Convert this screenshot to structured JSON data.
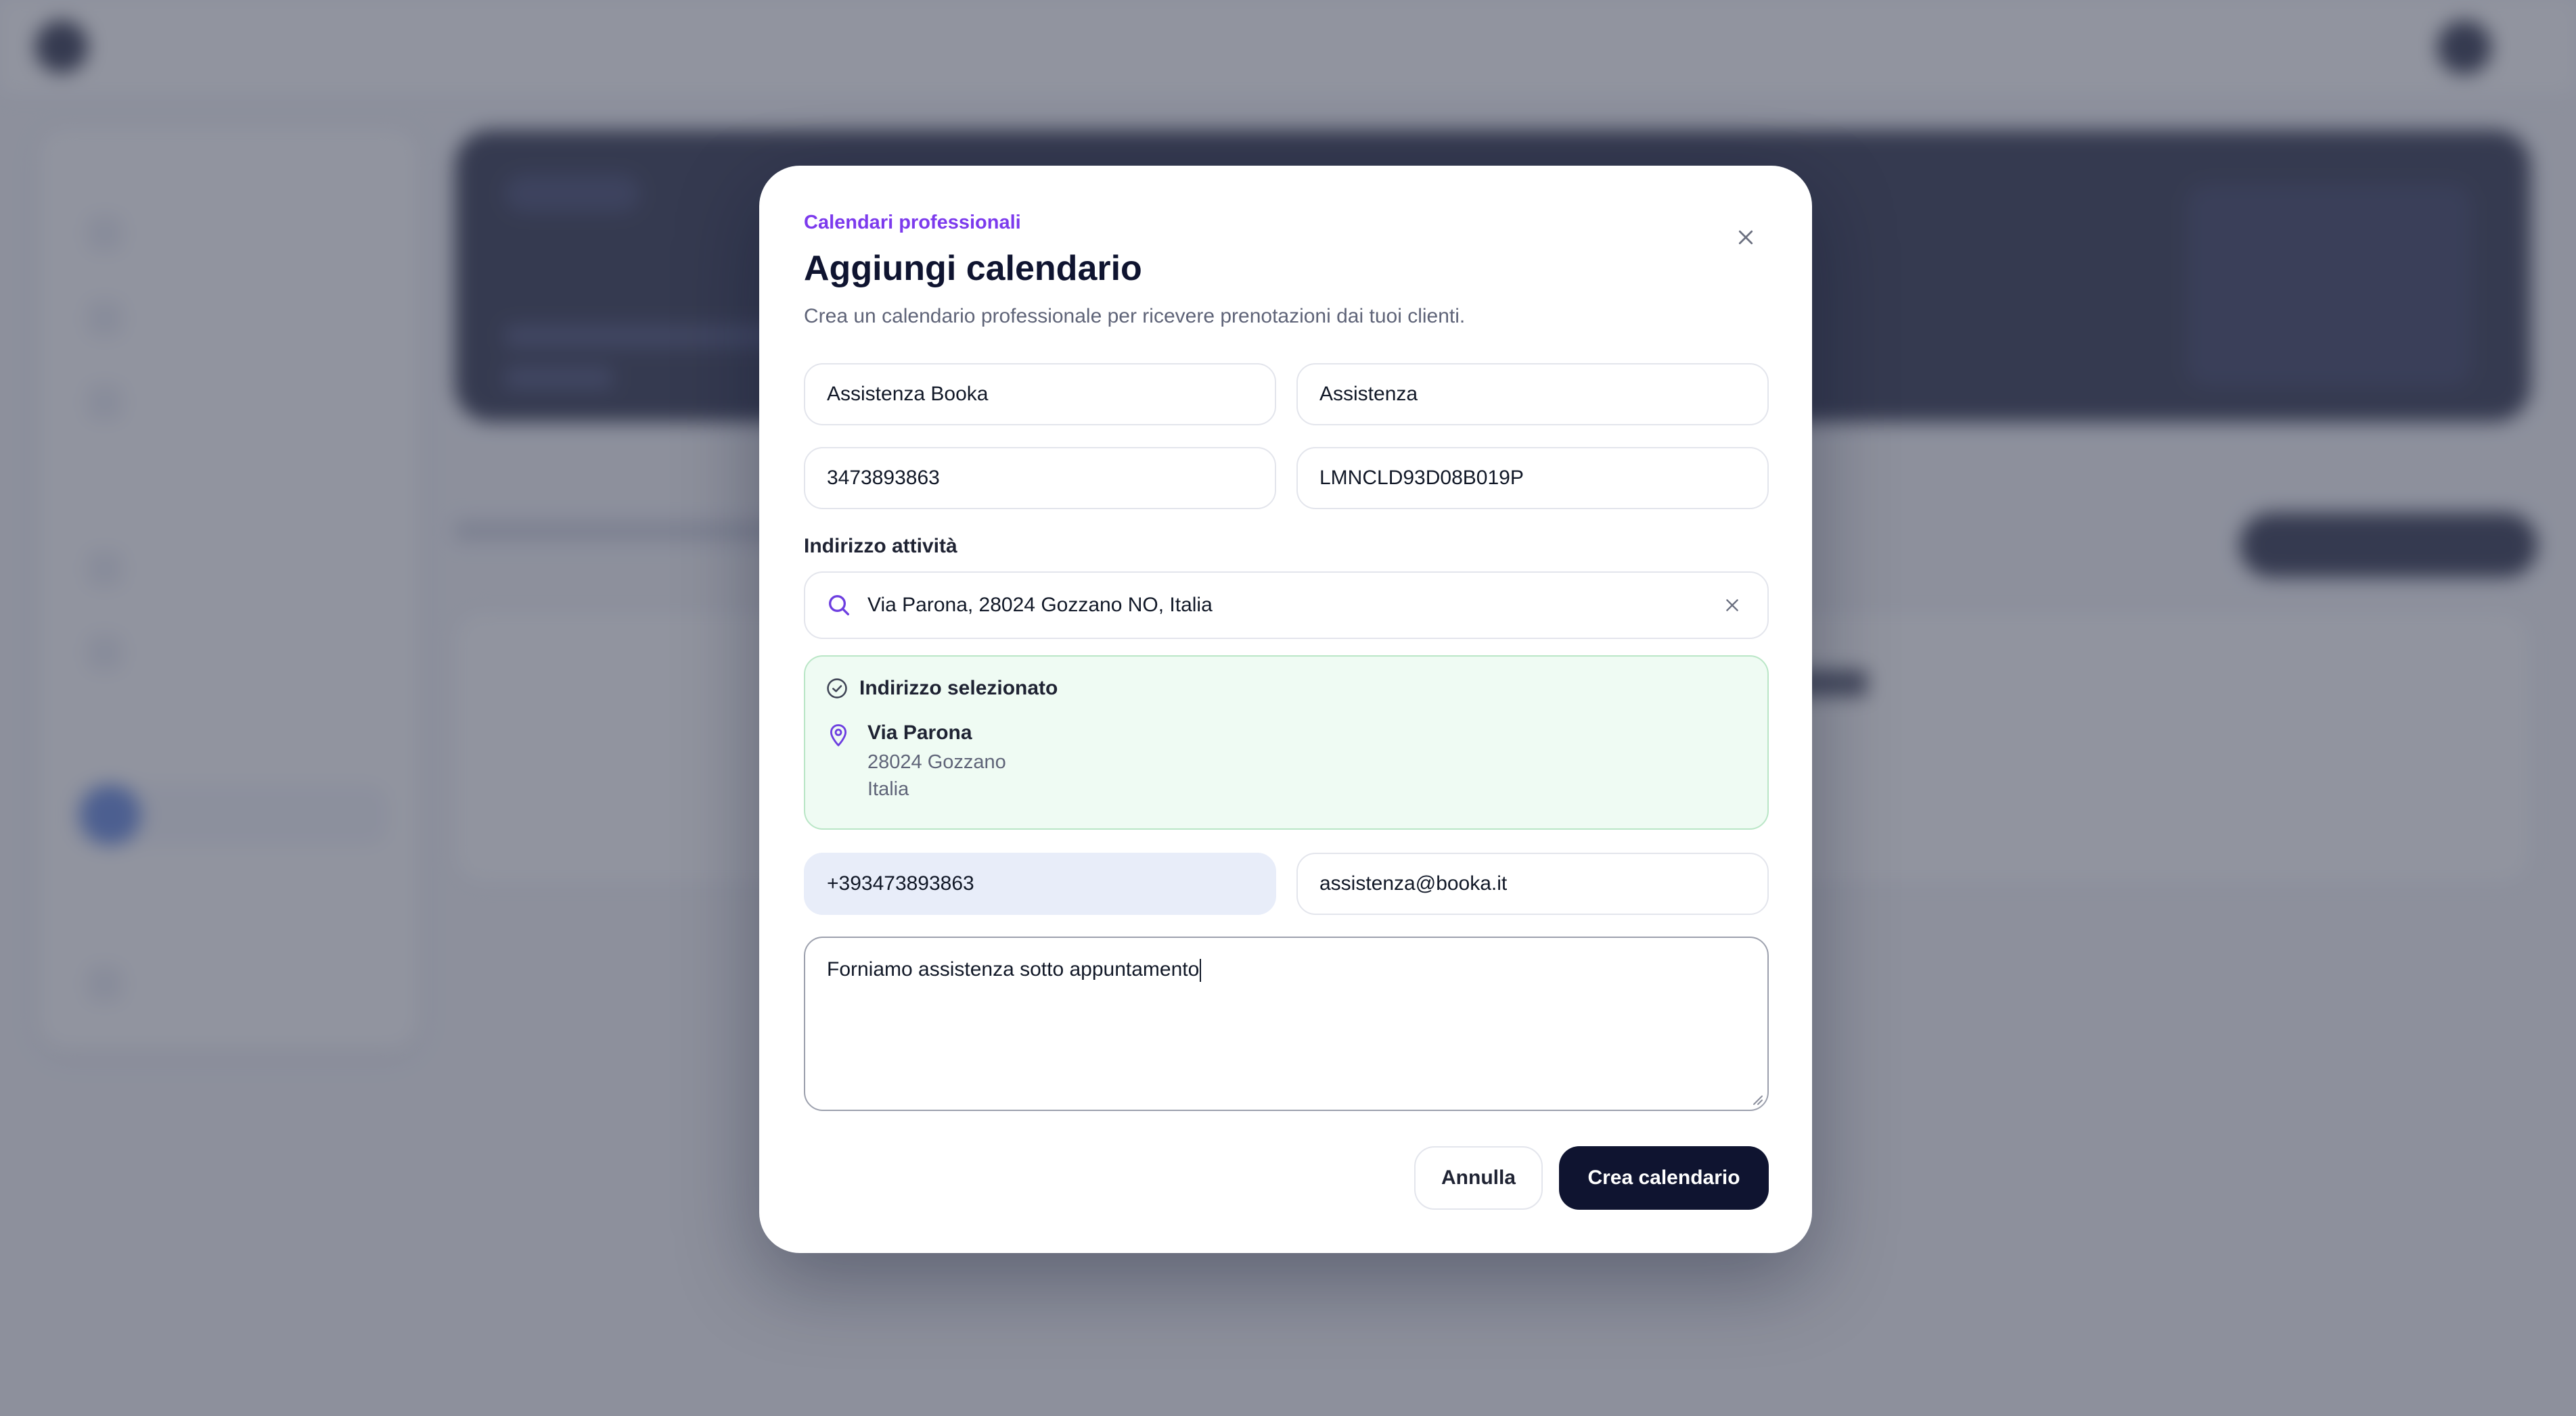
{
  "colors": {
    "accent": "#7c3aed",
    "primary": "#0f1430",
    "success_bg": "#effbf3",
    "success_border": "#b9e6c6",
    "overlay": "rgba(78,82,100,0.62)"
  },
  "modal": {
    "eyebrow": "Calendari professionali",
    "title": "Aggiungi calendario",
    "subtitle": "Crea un calendario professionale per ricevere prenotazioni dai tuoi clienti.",
    "close_icon": "close-icon",
    "fields": {
      "name": "Assistenza Booka",
      "category": "Assistenza",
      "vat": "3473893863",
      "tax_code": "LMNCLD93D08B019P",
      "phone": "+393473893863",
      "email": "assistenza@booka.it",
      "description": "Forniamo assistenza sotto appuntamento"
    },
    "address": {
      "label": "Indirizzo attività",
      "search_value": "Via Parona, 28024 Gozzano NO, Italia",
      "search_icon": "search-icon",
      "clear_icon": "close-icon",
      "selected_heading": "Indirizzo selezionato",
      "street": "Via Parona",
      "city_line": "28024 Gozzano",
      "country": "Italia"
    },
    "buttons": {
      "cancel": "Annulla",
      "create": "Crea calendario"
    }
  }
}
